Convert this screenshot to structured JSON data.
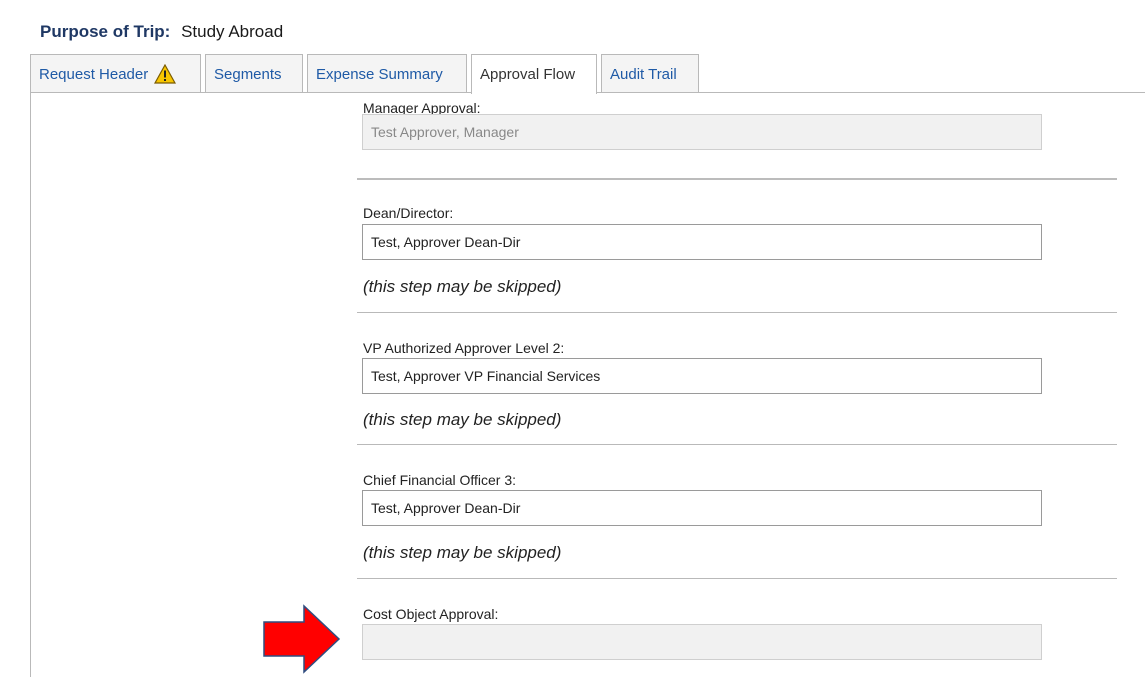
{
  "header": {
    "purpose_label": "Purpose of Trip:",
    "purpose_value": "Study Abroad"
  },
  "tabs": [
    {
      "label": "Request Header",
      "warning_icon": "warning-triangle-icon"
    },
    {
      "label": "Segments"
    },
    {
      "label": "Expense Summary"
    },
    {
      "label": "Approval Flow",
      "active": true
    },
    {
      "label": "Audit Trail"
    }
  ],
  "approvals": {
    "manager": {
      "label": "Manager Approval:",
      "value": "Test Approver, Manager"
    },
    "dean": {
      "label": "Dean/Director:",
      "value": "Test, Approver Dean-Dir",
      "note": "(this step may be skipped)"
    },
    "vp": {
      "label": "VP Authorized Approver Level 2:",
      "value": "Test, Approver  VP Financial Services",
      "note": "(this step may be skipped)"
    },
    "cfo": {
      "label": "Chief Financial Officer 3:",
      "value": "Test, Approver Dean-Dir",
      "note": "(this step may be skipped)"
    },
    "cost_object": {
      "label": "Cost Object Approval:",
      "value": ""
    }
  },
  "colors": {
    "arrow": "#ff0000",
    "arrow_outline": "#2f4d80",
    "tab_link": "#1f5aa6",
    "purpose_label": "#1f3864"
  },
  "annotation": {
    "icon": "red-arrow-pointer-icon"
  }
}
